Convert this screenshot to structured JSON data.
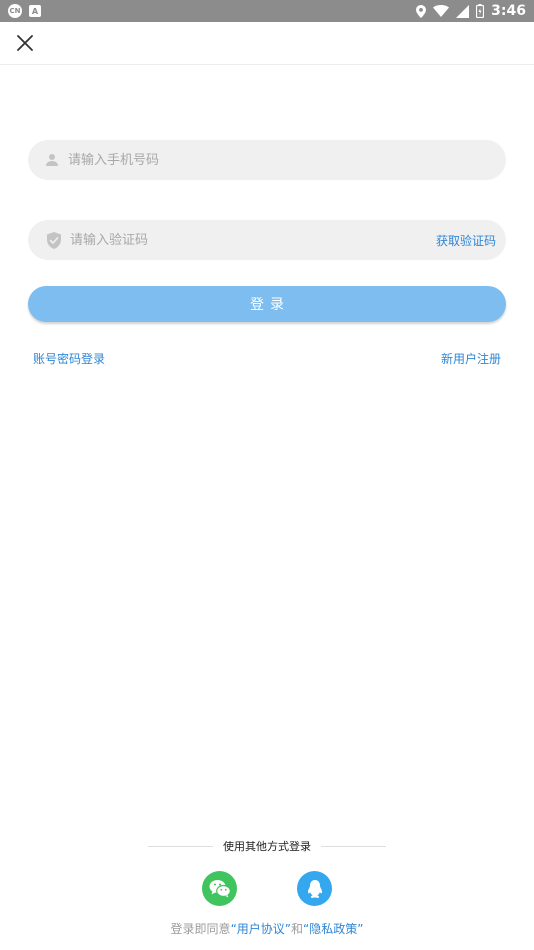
{
  "status_bar": {
    "badge_text": "CN",
    "square_text": "A",
    "time": "3:46"
  },
  "top_bar": {
    "close_icon": "close-icon"
  },
  "phone_input": {
    "placeholder": "请输入手机号码",
    "value": "",
    "icon": "user-icon"
  },
  "code_input": {
    "placeholder": "请输入验证码",
    "value": "",
    "icon": "shield-check-icon",
    "get_code_label": "获取验证码"
  },
  "login_button_label": "登录",
  "links": {
    "password_login": "账号密码登录",
    "register": "新用户注册"
  },
  "other_login": {
    "title": "使用其他方式登录",
    "wechat_icon": "wechat-icon",
    "qq_icon": "qq-icon"
  },
  "agreement": {
    "prefix": "登录即同意",
    "user_agreement": "“用户协议”",
    "and": "和",
    "privacy_policy": "“隐私政策”"
  },
  "colors": {
    "accent": "#2f86d6",
    "login_button": "#7dbdf0",
    "wechat": "#3fc45e",
    "qq": "#35a7ef",
    "status_bar": "#8c8c8c"
  }
}
